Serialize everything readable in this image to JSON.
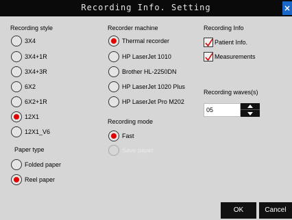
{
  "window": {
    "title": "Recording Info. Setting",
    "close_label": "×"
  },
  "recording_style": {
    "heading": "Recording style",
    "options": [
      {
        "label": "3X4",
        "checked": false
      },
      {
        "label": "3X4+1R",
        "checked": false
      },
      {
        "label": "3X4+3R",
        "checked": false
      },
      {
        "label": "6X2",
        "checked": false
      },
      {
        "label": "6X2+1R",
        "checked": false
      },
      {
        "label": "12X1",
        "checked": true
      },
      {
        "label": "12X1_V6",
        "checked": false
      }
    ]
  },
  "paper_type": {
    "heading": "Paper type",
    "options": [
      {
        "label": "Folded paper",
        "checked": false
      },
      {
        "label": "Reel paper",
        "checked": true
      }
    ]
  },
  "recorder_machine": {
    "heading": "Recorder machine",
    "options": [
      {
        "label": "Thermal recorder",
        "checked": true
      },
      {
        "label": "HP LaserJet 1010",
        "checked": false
      },
      {
        "label": "Brother HL-2250DN",
        "checked": false
      },
      {
        "label": "HP LaserJet 1020 Plus",
        "checked": false
      },
      {
        "label": "HP LaserJet Pro M202",
        "checked": false
      }
    ]
  },
  "recording_mode": {
    "heading": "Recording mode",
    "options": [
      {
        "label": "Fast",
        "checked": true,
        "disabled": false
      },
      {
        "label": "Save paper",
        "checked": false,
        "disabled": true
      }
    ]
  },
  "recording_info": {
    "heading": "Recording Info",
    "options": [
      {
        "label": "Patient Info.",
        "checked": true
      },
      {
        "label": "Measurements",
        "checked": true
      }
    ]
  },
  "recording_waves": {
    "label": "Recording waves(s)",
    "value": "05"
  },
  "buttons": {
    "ok": "OK",
    "cancel": "Cancel"
  },
  "colors": {
    "selected": "#e00000",
    "titlebar": "#0a0a0a",
    "close": "#1b66c9",
    "background": "#d6d6d6"
  }
}
